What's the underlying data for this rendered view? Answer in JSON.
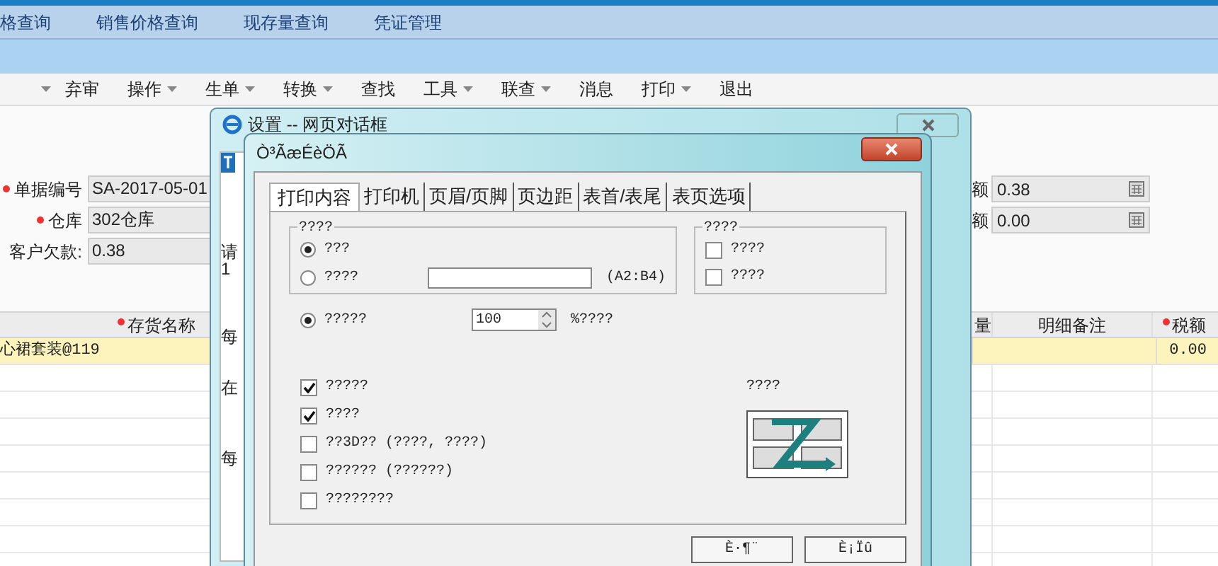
{
  "nav": {
    "items": [
      "格查询",
      "销售价格查询",
      "现存量查询",
      "凭证管理"
    ]
  },
  "toolbar": {
    "items": [
      {
        "label": "弃审",
        "menu": false
      },
      {
        "label": "操作",
        "menu": true
      },
      {
        "label": "生单",
        "menu": true
      },
      {
        "label": "转换",
        "menu": true
      },
      {
        "label": "查找",
        "menu": false
      },
      {
        "label": "工具",
        "menu": true
      },
      {
        "label": "联查",
        "menu": true
      },
      {
        "label": "消息",
        "menu": false
      },
      {
        "label": "打印",
        "menu": true
      },
      {
        "label": "退出",
        "menu": false
      }
    ]
  },
  "form": {
    "left_fields": [
      {
        "label": "单据编号",
        "required": true,
        "value": "SA-2017-05-01"
      },
      {
        "label": "仓库",
        "required": true,
        "value": "302仓库"
      },
      {
        "label": "客户欠款:",
        "required": false,
        "value": "0.38"
      }
    ],
    "right_fields": [
      {
        "label": "额",
        "value": "0.38"
      },
      {
        "label": "额",
        "value": "0.00"
      }
    ]
  },
  "grid": {
    "columns": [
      {
        "label": "存货名称",
        "required": true
      },
      {
        "label": "量",
        "required": false
      },
      {
        "label": "明细备注",
        "required": false
      },
      {
        "label": "税额",
        "required": true
      }
    ],
    "rows": [
      {
        "name": "心裙套装@119",
        "tax": "0.00",
        "selected": true
      }
    ]
  },
  "outer_dialog": {
    "title": "设置 -- 网页对话框",
    "fragments": [
      "请",
      "1",
      "每",
      "在",
      "每"
    ]
  },
  "dialog": {
    "title": "Ò³ÃæÉèÖÃ",
    "tabs": [
      {
        "label": "打印内容",
        "selected": true
      },
      {
        "label": "打印机",
        "selected": false
      },
      {
        "label": "页眉/页脚",
        "selected": false
      },
      {
        "label": "页边距",
        "selected": false
      },
      {
        "label": "表首/表尾",
        "selected": false
      },
      {
        "label": "表页选项",
        "selected": false
      }
    ],
    "range_group": {
      "title": "????",
      "options": [
        {
          "label": "???",
          "selected": true
        },
        {
          "label": "????",
          "selected": false,
          "hint": "(A2:B4)"
        }
      ]
    },
    "right_group": {
      "title": "????",
      "options": [
        {
          "label": "????",
          "checked": false
        },
        {
          "label": "????",
          "checked": false
        }
      ]
    },
    "scale": {
      "label": "?????",
      "selected": true,
      "value": "100",
      "suffix": "%????"
    },
    "checks": [
      {
        "label": "?????",
        "checked": true
      },
      {
        "label": "????",
        "checked": true
      },
      {
        "label": "??3D?? (????, ????)",
        "checked": false
      },
      {
        "label": "?????? (??????)",
        "checked": false
      },
      {
        "label": "????????",
        "checked": false
      }
    ],
    "order_label": "????",
    "buttons": [
      "È·¶¨",
      "È¡Ïû"
    ]
  }
}
